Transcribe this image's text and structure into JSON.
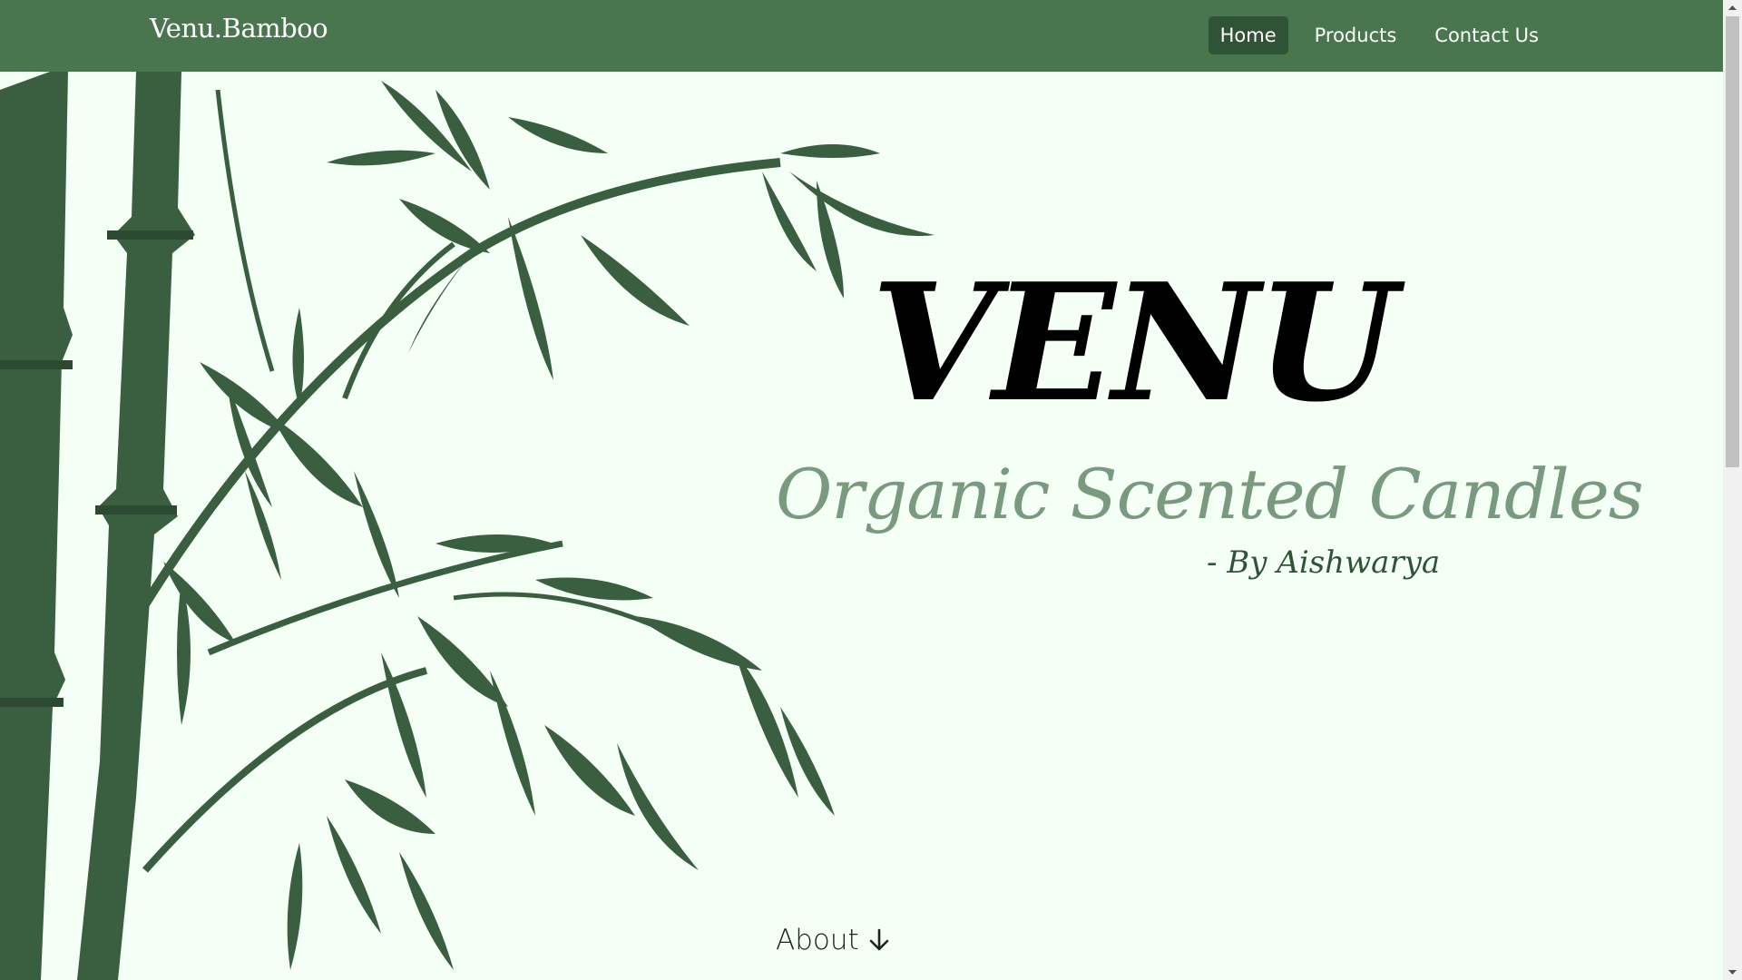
{
  "nav": {
    "brand": "Venu.Bamboo",
    "links": [
      {
        "label": "Home",
        "active": true
      },
      {
        "label": "Products",
        "active": false
      },
      {
        "label": "Contact Us",
        "active": false
      }
    ]
  },
  "hero": {
    "title": "VENU",
    "subtitle": "Organic Scented Candles",
    "author": "- By Aishwarya"
  },
  "about": {
    "label": "About",
    "icon": "arrow-down-icon"
  },
  "illustration": {
    "icon": "bamboo-illustration"
  },
  "colors": {
    "navbar": "#49764f",
    "active_link": "#2f5337",
    "background": "#f4fff6",
    "bamboo": "#3a5f40",
    "subtitle": "#7a9a7f"
  }
}
